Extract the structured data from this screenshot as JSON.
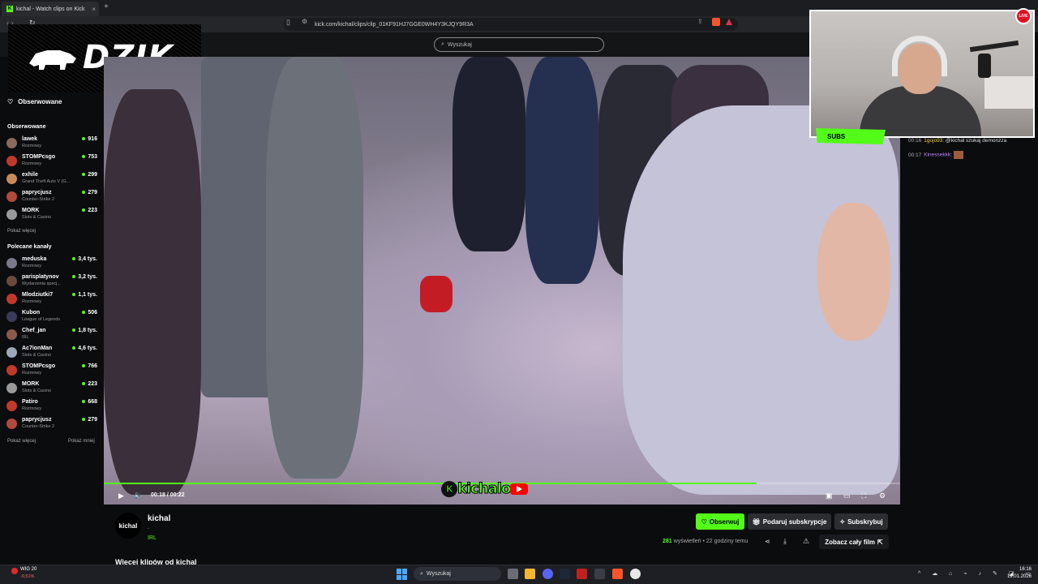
{
  "browser": {
    "tab_title": "kichal - Watch clips on Kick",
    "tab_close": "×",
    "new_tab": "+",
    "url": "kick.com/kichal/clips/clip_01KF91HJ7GGE0WH4Y3KJQY9R3A"
  },
  "header": {
    "search_placeholder": "Wyszukaj"
  },
  "overlay": {
    "logo_text": "DZIK",
    "webcam_badge": "SUBS",
    "rec_badge": "LIVE"
  },
  "sidebar": {
    "followed_link": "Obserwowane",
    "followed_section": "Obserwowane",
    "followed": [
      {
        "name": "lawek",
        "category": "Rozmowy",
        "viewers": "916",
        "color": "#8a6a5a"
      },
      {
        "name": "STOMPcsgo",
        "category": "Rozmowy",
        "viewers": "753",
        "color": "#c0392b"
      },
      {
        "name": "exhile",
        "category": "Grand Theft Auto V (G...",
        "viewers": "299",
        "color": "#c98a5a"
      },
      {
        "name": "paprycjusz",
        "category": "Counter-Strike 2",
        "viewers": "279",
        "color": "#b04a3a"
      },
      {
        "name": "MORK",
        "category": "Slots & Casino",
        "viewers": "223",
        "color": "#9a9a9a"
      }
    ],
    "show_more_followed": "Pokaż więcej",
    "recommended_section": "Polecane kanały",
    "recommended": [
      {
        "name": "meduska",
        "category": "Rozmowy",
        "viewers": "3,4 tys.",
        "color": "#7a7a8a"
      },
      {
        "name": "parisplatynov",
        "category": "Wydarzenia specj...",
        "viewers": "3,2 tys.",
        "color": "#6a4a3a"
      },
      {
        "name": "Mlodziutki7",
        "category": "Rozmowy",
        "viewers": "1,1 tys.",
        "color": "#c0392b"
      },
      {
        "name": "Kubon",
        "category": "League of Legends",
        "viewers": "506",
        "color": "#3a3a5a"
      },
      {
        "name": "Chef_jan",
        "category": "IRL",
        "viewers": "1,8 tys.",
        "color": "#8a5a4a"
      },
      {
        "name": "Ac7ionMan",
        "category": "Slots & Casino",
        "viewers": "4,6 tys.",
        "color": "#9aaaba"
      },
      {
        "name": "STOMPcsgo",
        "category": "Rozmowy",
        "viewers": "766",
        "color": "#c0392b"
      },
      {
        "name": "MORK",
        "category": "Slots & Casino",
        "viewers": "223",
        "color": "#9a9a9a"
      },
      {
        "name": "Patiro",
        "category": "Rozmowy",
        "viewers": "668",
        "color": "#c0392b"
      },
      {
        "name": "paprycjusz",
        "category": "Counter-Strike 2",
        "viewers": "279",
        "color": "#b04a3a"
      }
    ],
    "show_more": "Pokaż więcej",
    "show_less": "Pokaż mniej"
  },
  "video": {
    "time": "00:18 / 00:22",
    "progress": 0.82,
    "watermark_text": "kichalo"
  },
  "clip": {
    "channel": "kichal",
    "avatar_text": "kichal",
    "title": ".",
    "category": "IRL",
    "follow_label": "Obserwuj",
    "gift_label": "Podaruj subskrypcje",
    "subscribe_label": "Subskrybuj",
    "views_count": "281",
    "views_label": "wyświetleń",
    "age": "• 22 godziny temu",
    "full_film_label": "Zobacz cały film",
    "more_clips": "Więcej klipów od kichal"
  },
  "chat": {
    "messages": [
      {
        "time": "00:16",
        "user": "1gojo93",
        "user_color": "#f2c94c",
        "text": ": @kichal szukaj demonzza"
      },
      {
        "time": "00:17",
        "user": "Kinessekkk",
        "user_color": "#b983ff",
        "text": ":"
      }
    ]
  },
  "taskbar": {
    "ticker_name": "WIG 20",
    "ticker_change": "-0,51%",
    "search_placeholder": "Wyszukaj",
    "time": "16:16",
    "date": "19.01.2026"
  }
}
